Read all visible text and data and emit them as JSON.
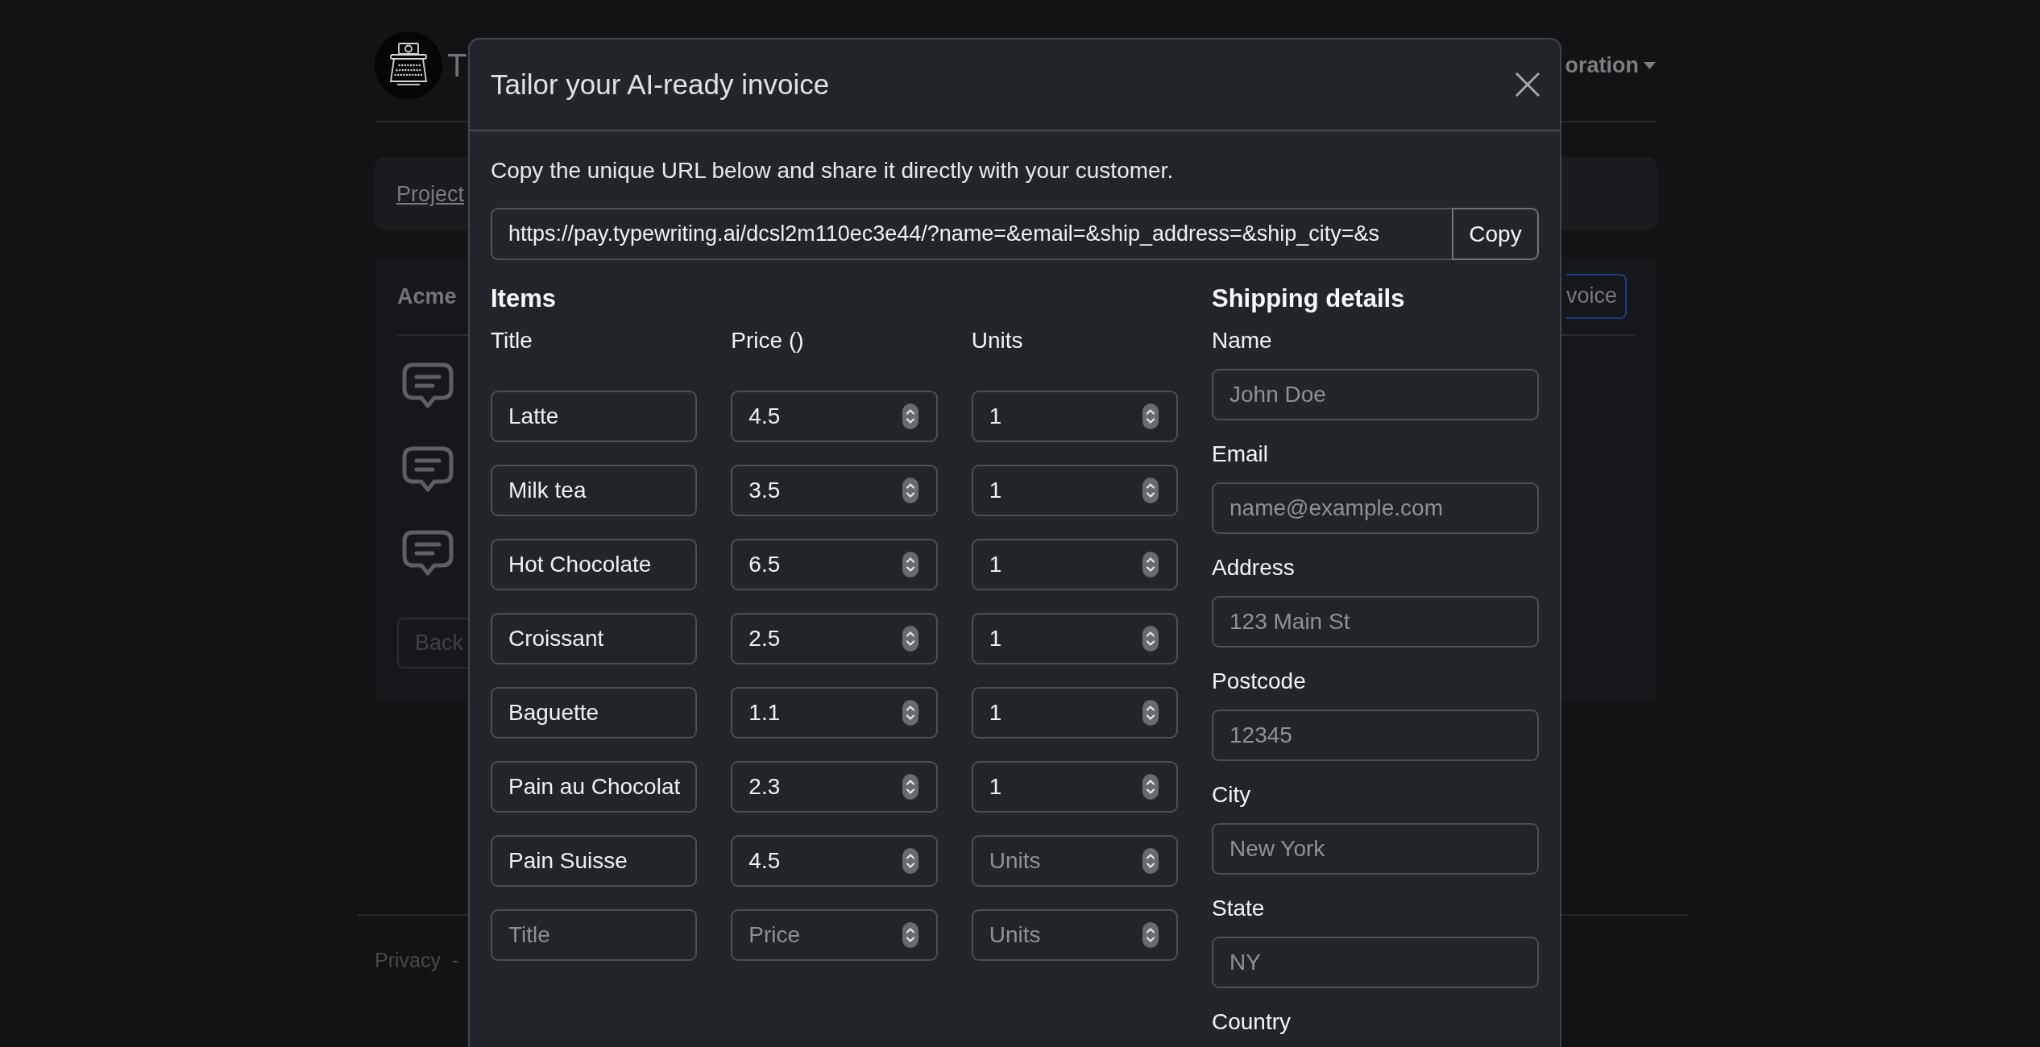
{
  "page_behind": {
    "brand": {
      "text": "T"
    },
    "nav_menu": {
      "label": "oration"
    },
    "breadcrumb": {
      "link": "Project"
    },
    "card": {
      "title": "Acme",
      "action_button": "voice",
      "back_button": "Back"
    },
    "footer": {
      "link": "Privacy",
      "separator": "-"
    }
  },
  "modal": {
    "title": "Tailor your AI-ready invoice",
    "intro": "Copy the unique URL below and share it directly with your customer.",
    "share_url": {
      "value": "https://pay.typewriting.ai/dcsl2m110ec3e44/?name=&email=&ship_address=&ship_city=&s",
      "button": "Copy"
    },
    "items": {
      "heading": "Items",
      "columns": [
        "Title",
        "Price ()",
        "Units"
      ],
      "rows": [
        {
          "cells": [
            {
              "kind": "text",
              "value": "Latte"
            },
            {
              "kind": "number",
              "value": "4.5"
            },
            {
              "kind": "number",
              "value": "1"
            }
          ]
        },
        {
          "cells": [
            {
              "kind": "text",
              "value": "Milk tea"
            },
            {
              "kind": "number",
              "value": "3.5"
            },
            {
              "kind": "number",
              "value": "1"
            }
          ]
        },
        {
          "cells": [
            {
              "kind": "text",
              "value": "Hot Chocolate"
            },
            {
              "kind": "number",
              "value": "6.5"
            },
            {
              "kind": "number",
              "value": "1"
            }
          ]
        },
        {
          "cells": [
            {
              "kind": "text",
              "value": "Croissant"
            },
            {
              "kind": "number",
              "value": "2.5"
            },
            {
              "kind": "number",
              "value": "1"
            }
          ]
        },
        {
          "cells": [
            {
              "kind": "text",
              "value": "Baguette"
            },
            {
              "kind": "number",
              "value": "1.1"
            },
            {
              "kind": "number",
              "value": "1"
            }
          ]
        },
        {
          "cells": [
            {
              "kind": "text",
              "value": "Pain au Chocolat"
            },
            {
              "kind": "number",
              "value": "2.3"
            },
            {
              "kind": "number",
              "value": "1"
            }
          ]
        },
        {
          "cells": [
            {
              "kind": "text",
              "value": "Pain Suisse"
            },
            {
              "kind": "number",
              "value": "4.5"
            },
            {
              "kind": "number",
              "placeholder": "Units"
            }
          ]
        },
        {
          "cells": [
            {
              "kind": "text",
              "placeholder": "Title"
            },
            {
              "kind": "number",
              "placeholder": "Price"
            },
            {
              "kind": "number",
              "placeholder": "Units"
            }
          ]
        }
      ]
    },
    "shipping": {
      "heading": "Shipping details",
      "fields": [
        {
          "label": "Name",
          "placeholder": "John Doe"
        },
        {
          "label": "Email",
          "placeholder": "name@example.com"
        },
        {
          "label": "Address",
          "placeholder": "123 Main St"
        },
        {
          "label": "Postcode",
          "placeholder": "12345"
        },
        {
          "label": "City",
          "placeholder": "New York"
        },
        {
          "label": "State",
          "placeholder": "NY"
        },
        {
          "label": "Country"
        }
      ]
    }
  }
}
